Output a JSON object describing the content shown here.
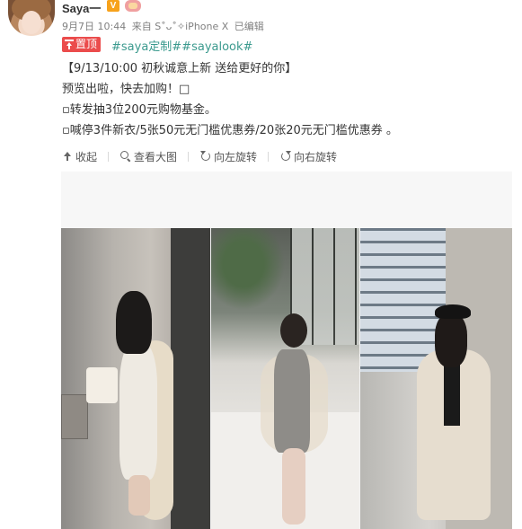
{
  "user": {
    "name": "Saya一",
    "vip_badge": "V"
  },
  "post_meta": {
    "date": "9月7日 10:44",
    "source": "来自 S˚ᴗ˚✧iPhone X",
    "edited": "已编辑"
  },
  "pin": {
    "label": "置顶"
  },
  "hashtags": "#saya定制##sayalook#",
  "content": {
    "line1": "【9/13/10:00 初秋诚意上新 送给更好的你】",
    "line2": "预览出啦，快去加购！□",
    "line3": "▫转发抽3位200元购物基金。",
    "line4": "▫喊停3件新衣/5张50元无门槛优惠券/20张20元无门槛优惠券 。"
  },
  "toolbar": {
    "collapse": "收起",
    "view_large": "查看大图",
    "rotate_left": "向左旋转",
    "rotate_right": "向右旋转"
  },
  "colors": {
    "pin_bg": "#eb4c4c",
    "hashtag": "#3b9a8e",
    "meta": "#808080",
    "text": "#333333"
  },
  "icons": [
    "collapse-icon",
    "zoom-icon",
    "rotate-left-icon",
    "rotate-right-icon",
    "pin-icon"
  ]
}
